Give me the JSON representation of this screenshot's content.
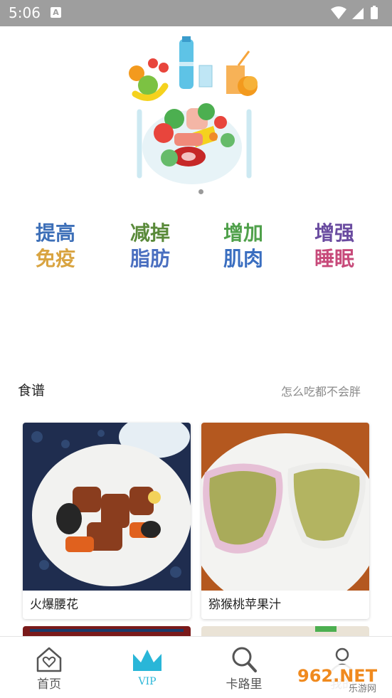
{
  "status_bar": {
    "time": "5:06",
    "notification_icon": "A"
  },
  "banner": {
    "image": "food-illustration",
    "page_indicator": "1"
  },
  "goals": [
    {
      "line1": "提高",
      "line2": "免疫",
      "c1": "#3d6fb8",
      "c2": "#d9a441"
    },
    {
      "line1": "减掉",
      "line2": "脂肪",
      "c1": "#5a8a3a",
      "c2": "#4a6fc0"
    },
    {
      "line1": "增加",
      "line2": "肌肉",
      "c1": "#4fa04a",
      "c2": "#3a6ec0"
    },
    {
      "line1": "增强",
      "line2": "睡眠",
      "c1": "#6a4ca0",
      "c2": "#c74a7a"
    }
  ],
  "recipes": {
    "title": "食谱",
    "subtitle": "怎么吃都不会胖",
    "items": [
      {
        "name": "火爆腰花"
      },
      {
        "name": "猕猴桃苹果汁"
      }
    ]
  },
  "tabbar": {
    "tabs": [
      {
        "label": "首页",
        "icon": "home-heart-icon"
      },
      {
        "label": "VIP",
        "icon": "crown-icon"
      },
      {
        "label": "卡路里",
        "icon": "search-icon"
      },
      {
        "label": "我的",
        "icon": "user-icon"
      }
    ],
    "accent": "#29b6d8"
  },
  "watermark": {
    "brand": "962.NET",
    "sub": "乐游网"
  }
}
